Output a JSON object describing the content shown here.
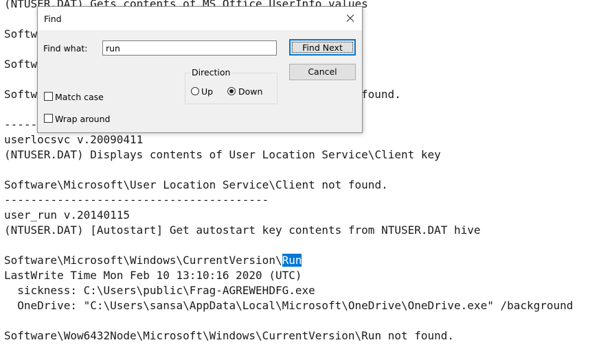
{
  "editor": {
    "lines": [
      "(NTUSER.DAT) Gets contents of MS Office UserInfo values",
      "",
      "Softw",
      "",
      "Softw",
      "",
      "Softw",
      "",
      "-----",
      "userlocsvc v.20090411",
      "(NTUSER.DAT) Displays contents of User Location Service\\Client key",
      "",
      "Software\\Microsoft\\User Location Service\\Client not found.",
      "----------------------------------------",
      "user_run v.20140115",
      "(NTUSER.DAT) [Autostart] Get autostart key contents from NTUSER.DAT hive",
      "",
      "Software\\Microsoft\\Windows\\CurrentVersion\\",
      "LastWrite Time Mon Feb 10 13:10:16 2020 (UTC)",
      "  sickness: C:\\Users\\public\\Frag-AGREWEHDFG.exe",
      "  OneDrive: \"C:\\Users\\sansa\\AppData\\Local\\Microsoft\\OneDrive\\OneDrive.exe\" /background",
      "",
      "Software\\Wow6432Node\\Microsoft\\Windows\\CurrentVersion\\Run not found."
    ],
    "partial_found_text": "found.",
    "selected_text": "Run",
    "selection_color": "#0078d7"
  },
  "find_dialog": {
    "title": "Find",
    "find_what_label": "Find what:",
    "find_what_value": "run",
    "find_next_label": "Find Next",
    "cancel_label": "Cancel",
    "direction_label": "Direction",
    "up_label": "Up",
    "down_label": "Down",
    "direction_selected": "Down",
    "match_case_label": "Match case",
    "match_case_checked": false,
    "wrap_around_label": "Wrap around",
    "wrap_around_checked": false
  }
}
